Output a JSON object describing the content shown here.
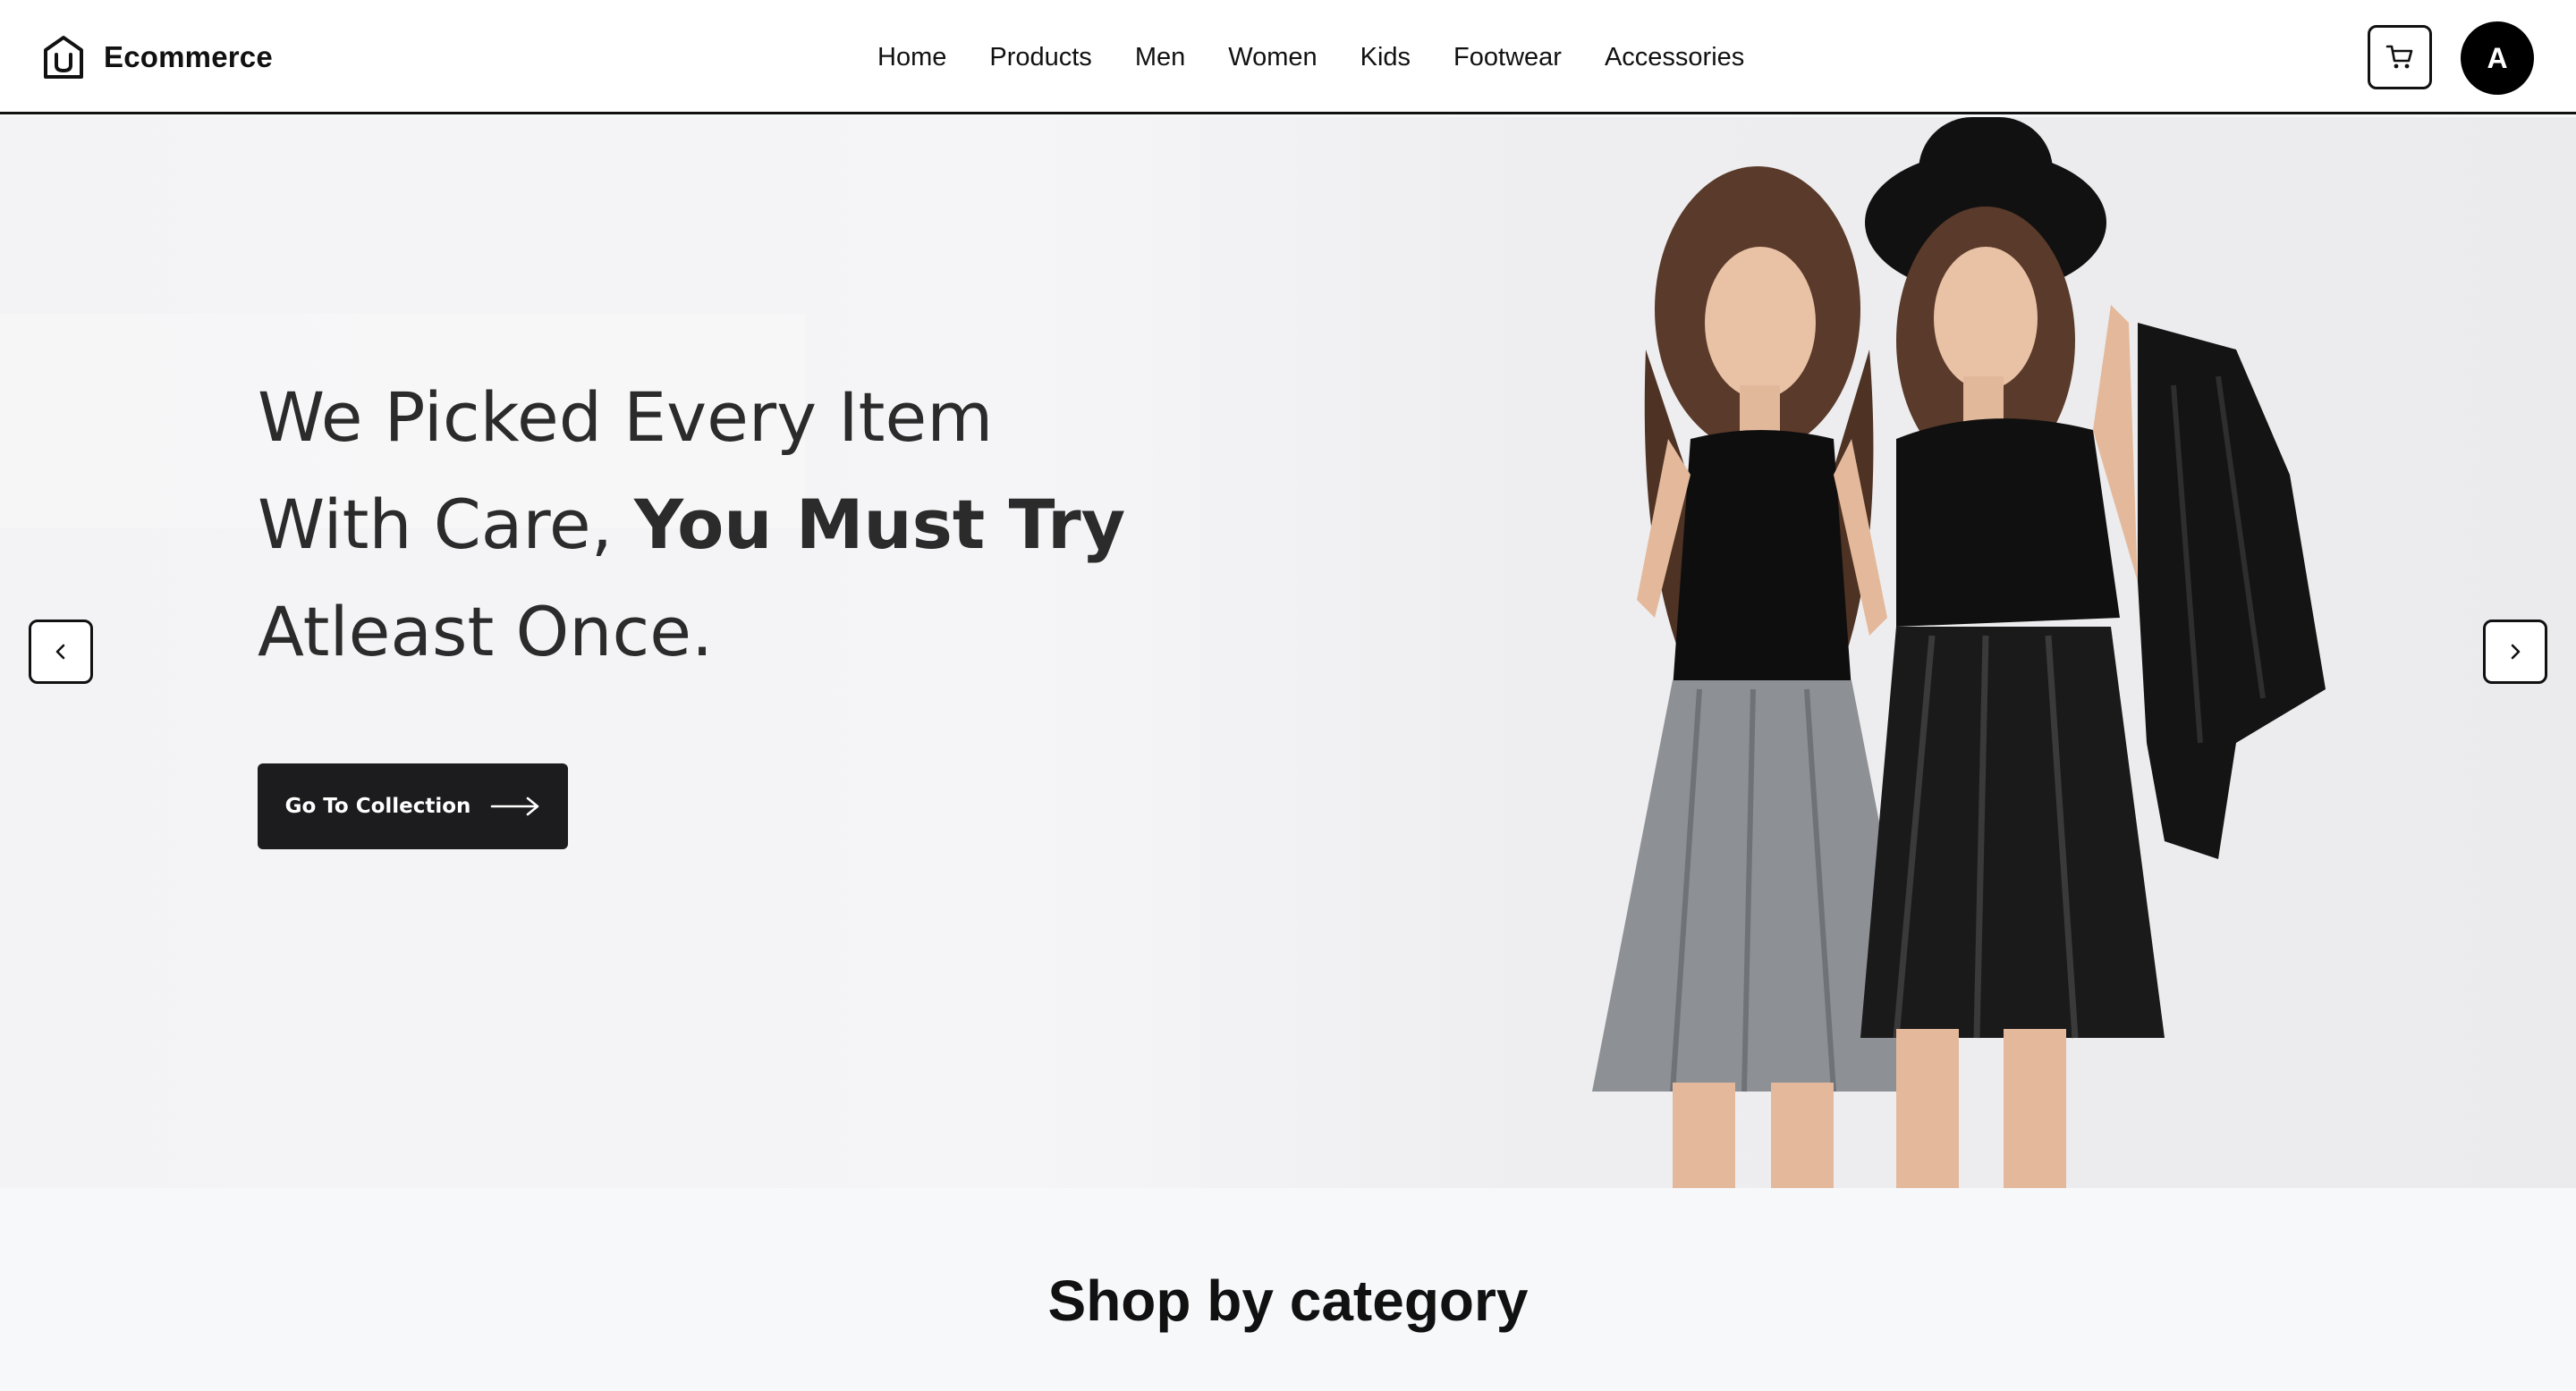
{
  "brand": {
    "name": "Ecommerce",
    "logo_icon": "shopping-bag-logo-icon"
  },
  "nav": {
    "items": [
      {
        "label": "Home"
      },
      {
        "label": "Products"
      },
      {
        "label": "Men"
      },
      {
        "label": "Women"
      },
      {
        "label": "Kids"
      },
      {
        "label": "Footwear"
      },
      {
        "label": "Accessories"
      }
    ]
  },
  "header": {
    "cart_icon": "cart-icon",
    "avatar_initial": "A"
  },
  "hero": {
    "title_line1": "We Picked Every Item",
    "title_line2_regular": "With Care,",
    "title_line2_bold": "You Must Try",
    "title_line3": "Atleast Once.",
    "cta_label": "Go To Collection",
    "cta_icon": "arrow-right-icon",
    "prev_icon": "chevron-left-icon",
    "next_icon": "chevron-right-icon"
  },
  "categories": {
    "title": "Shop by category"
  },
  "colors": {
    "header_bg": "#ffffff",
    "text": "#111111",
    "cta_bg": "#1c1c1e",
    "avatar_bg": "#000000",
    "hero_bg": "#f3f3f5",
    "page_bg": "#f7f8fa"
  }
}
